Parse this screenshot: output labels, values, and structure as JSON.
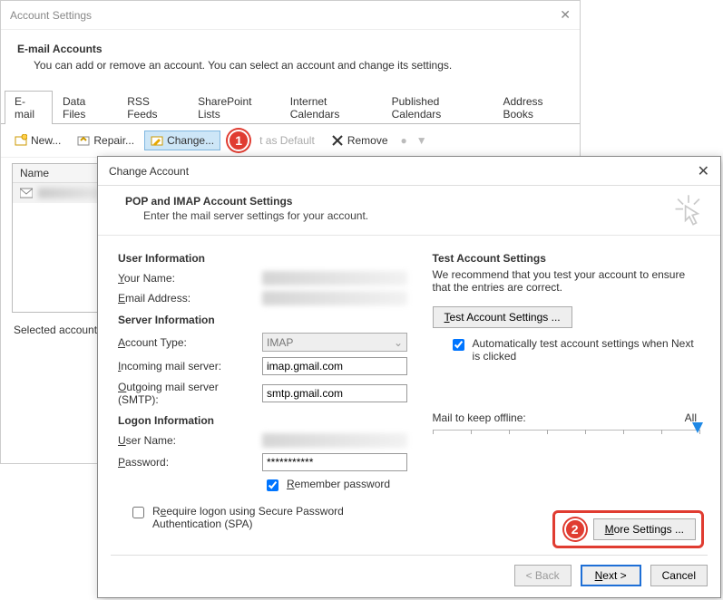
{
  "back": {
    "title": "Account Settings",
    "heading": "E-mail Accounts",
    "subtext": "You can add or remove an account. You can select an account and change its settings.",
    "tabs": [
      "E-mail",
      "Data Files",
      "RSS Feeds",
      "SharePoint Lists",
      "Internet Calendars",
      "Published Calendars",
      "Address Books"
    ],
    "toolbar": {
      "new_": "New...",
      "repair": "Repair...",
      "change": "Change...",
      "set_default": "t as Default",
      "remove": "Remove"
    },
    "col_name": "Name",
    "footer_text": "Selected account de",
    "callout1": "1"
  },
  "front": {
    "title": "Change Account",
    "heading": "POP and IMAP Account Settings",
    "subtext": "Enter the mail server settings for your account.",
    "sections": {
      "user_info": "User Information",
      "server_info": "Server Information",
      "logon_info": "Logon Information",
      "test_title": "Test Account Settings",
      "test_text": "We recommend that you test your account to ensure that the entries are correct."
    },
    "labels": {
      "your_name": "our Name:",
      "email": "mail Address:",
      "account_type": "ccount Type:",
      "incoming": "ncoming mail server:",
      "outgoing": "utgoing mail server (SMTP):",
      "username": "ser Name:",
      "password": "assword:",
      "remember": "emember password",
      "require_spa": "equire logon using Secure Password Authentication (SPA)",
      "auto_test": "Automatically test account settings when Next is clicked",
      "mail_offline": "Mail to keep offline:",
      "mail_offline_val": "All"
    },
    "values": {
      "account_type": "IMAP",
      "incoming": "imap.gmail.com",
      "outgoing": "smtp.gmail.com",
      "password": "***********"
    },
    "buttons": {
      "test": "Test Account Settings ...",
      "more": "More Settings ...",
      "back": "< Back",
      "next": "Next >",
      "cancel": "Cancel"
    },
    "callout2": "2"
  }
}
